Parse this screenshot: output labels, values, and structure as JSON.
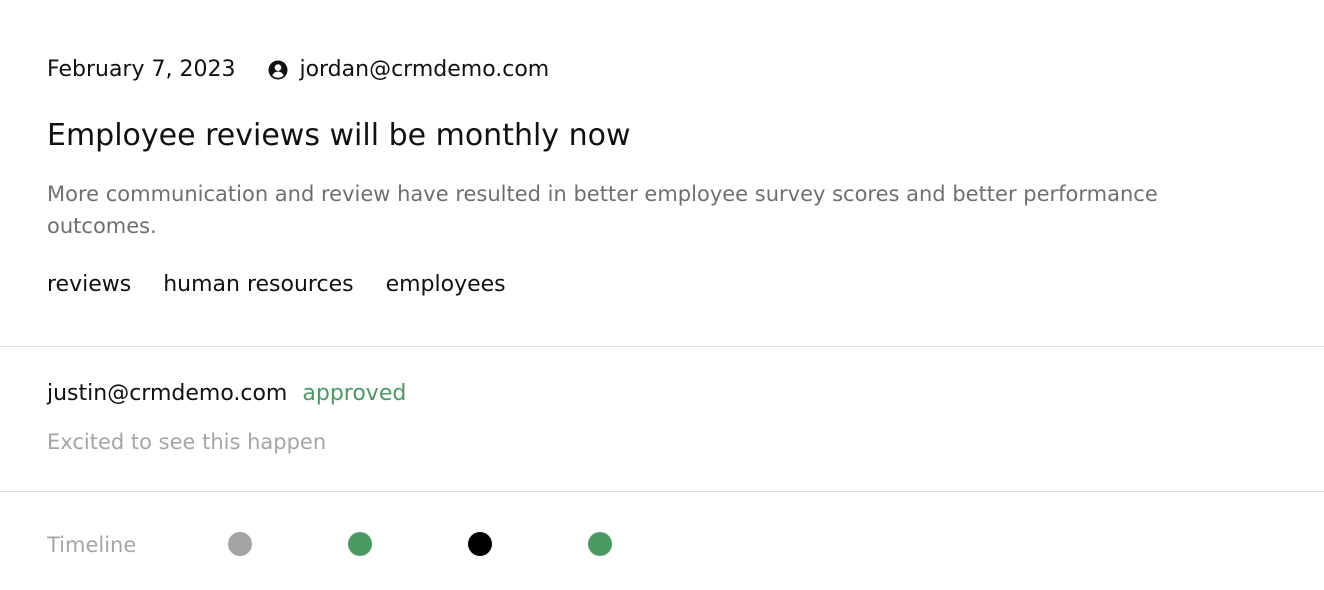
{
  "post": {
    "date": "February 7, 2023",
    "author": "jordan@crmdemo.com",
    "author_icon": "user-circle-icon",
    "title": "Employee reviews will be monthly now",
    "summary": "More communication and review have resulted in better employee survey scores and better performance outcomes.",
    "tags": [
      "reviews",
      "human resources",
      "employees"
    ]
  },
  "comment": {
    "author": "justin@crmdemo.com",
    "status": "approved",
    "status_color": "#4a9a5f",
    "body": "Excited to see this happen"
  },
  "timeline": {
    "label": "Timeline",
    "dots": [
      {
        "color": "#a3a3a3"
      },
      {
        "color": "#4a9a5f"
      },
      {
        "color": "#000000"
      },
      {
        "color": "#4a9a5f"
      }
    ]
  }
}
